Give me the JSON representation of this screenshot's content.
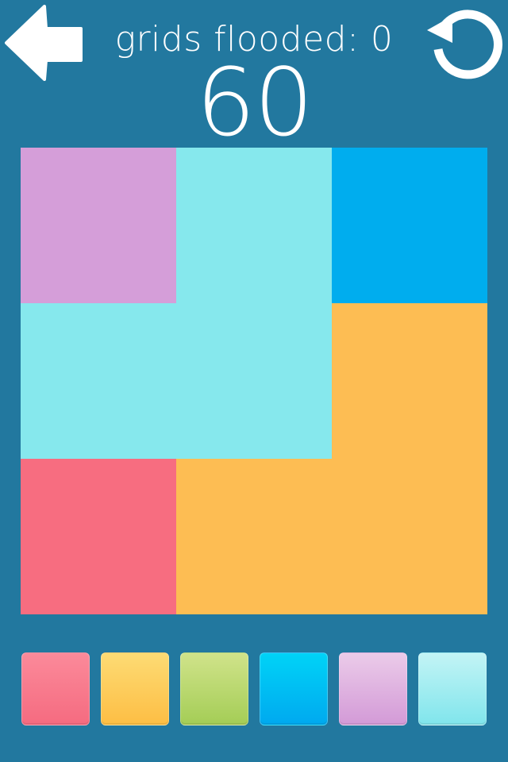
{
  "header": {
    "grids_flooded": "grids flooded: 0",
    "moves_left": "60"
  },
  "colors": {
    "background": "#22789f",
    "red": "#f76d80",
    "orange": "#fdbd53",
    "green": "#a7cf5a",
    "blue": "#00adee",
    "purple": "#d59ed9",
    "cyan": "#86e8ed"
  },
  "board": {
    "rows": 3,
    "cols": 3,
    "cells": [
      "purple",
      "cyan",
      "blue",
      "cyan",
      "cyan",
      "orange",
      "red",
      "orange",
      "orange"
    ]
  },
  "palette": [
    {
      "name": "red",
      "top": "#fb8a9a",
      "bottom": "#f56b80"
    },
    {
      "name": "orange",
      "top": "#fddb74",
      "bottom": "#fdbe44"
    },
    {
      "name": "green",
      "top": "#d0e38a",
      "bottom": "#a4cd56"
    },
    {
      "name": "blue",
      "top": "#00d3f7",
      "bottom": "#00a9ef"
    },
    {
      "name": "purple",
      "top": "#ebcbe9",
      "bottom": "#d39ad7"
    },
    {
      "name": "cyan",
      "top": "#c3f4f5",
      "bottom": "#80e5ec"
    }
  ]
}
